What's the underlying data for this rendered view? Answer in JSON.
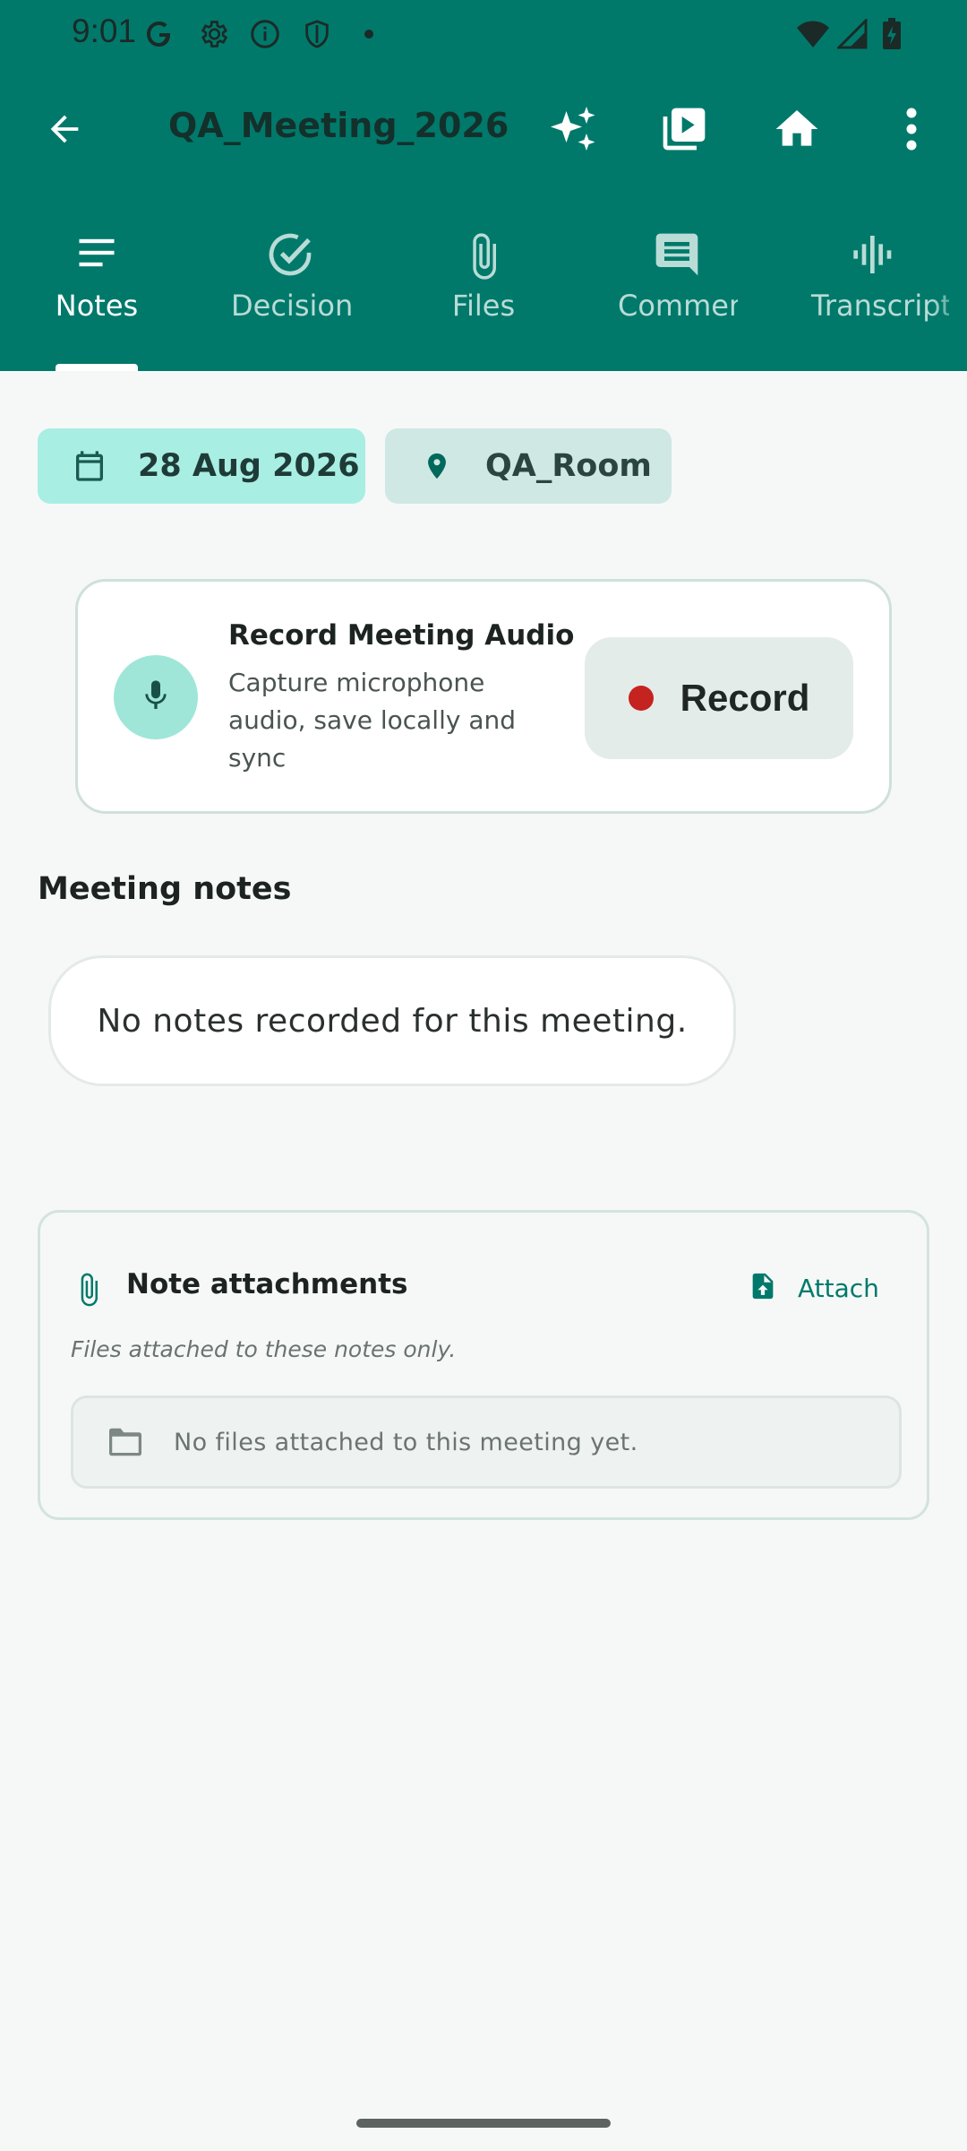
{
  "status_bar": {
    "time": "9:01",
    "icons": [
      "google-g-icon",
      "settings-gear-icon",
      "info-icon",
      "shield-icon",
      "dot-icon",
      "wifi-icon",
      "signal-icon",
      "battery-charging-icon"
    ]
  },
  "toolbar": {
    "title": "QA_Meeting_2026",
    "actions": [
      "back-arrow-icon",
      "ai-sparkle-icon",
      "playlist-play-icon",
      "home-icon",
      "more-vert-icon"
    ]
  },
  "tabs": [
    {
      "label": "Notes",
      "icon": "notes-lines-icon",
      "active": true
    },
    {
      "label": "Decisions",
      "icon": "check-circle-icon",
      "active": false
    },
    {
      "label": "Files",
      "icon": "paperclip-icon",
      "active": false
    },
    {
      "label": "Comments",
      "icon": "comment-icon",
      "active": false
    },
    {
      "label": "Transcript",
      "icon": "audio-wave-icon",
      "active": false
    }
  ],
  "meta": {
    "date": "28 Aug 2026",
    "location": "QA_Room"
  },
  "record_card": {
    "title": "Record Meeting Audio",
    "description": "Capture microphone audio, save locally and sync",
    "button_label": "Record"
  },
  "notes": {
    "section_title": "Meeting notes",
    "empty_text": "No notes recorded for this meeting."
  },
  "attachments": {
    "title": "Note attachments",
    "attach_label": "Attach",
    "subtitle": "Files attached to these notes only.",
    "empty_text": "No files attached to this meeting yet."
  },
  "colors": {
    "primary": "#00796b",
    "chip_date": "#a8eee3",
    "chip_room": "#cfe8e3",
    "record_dot": "#c5231f"
  }
}
